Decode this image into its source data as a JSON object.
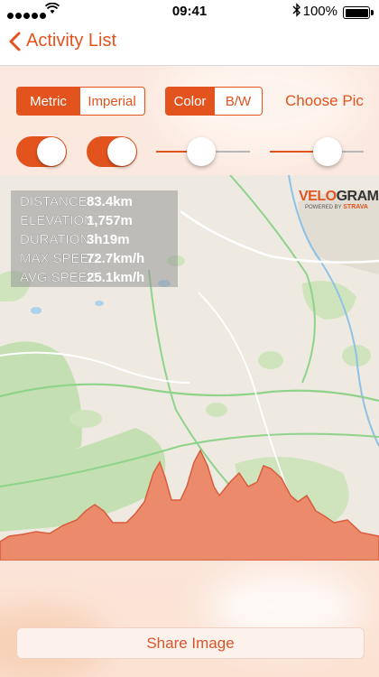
{
  "status_bar": {
    "time": "09:41",
    "battery": "100%",
    "battery_level": 1.0
  },
  "nav": {
    "back_label": "Activity List"
  },
  "controls": {
    "units": {
      "options": [
        "Metric",
        "Imperial"
      ],
      "selected": "Metric"
    },
    "color_mode": {
      "options": [
        "Color",
        "B/W"
      ],
      "selected": "Color"
    },
    "choose_pic_label": "Choose Pic",
    "toggles": [
      {
        "name": "toggle-1",
        "on": true
      },
      {
        "name": "toggle-2",
        "on": true
      }
    ],
    "sliders": [
      {
        "name": "slider-1",
        "value": 0.48
      },
      {
        "name": "slider-2",
        "value": 0.62
      }
    ]
  },
  "stats": [
    {
      "label": "DISTANCE",
      "value": "83.4km"
    },
    {
      "label": "ELEVATION",
      "value": "1,757m"
    },
    {
      "label": "DURATION",
      "value": "3h19m"
    },
    {
      "label": "MAX SPEED",
      "value": "72.7km/h"
    },
    {
      "label": "AVG SPEED",
      "value": "25.1km/h"
    }
  ],
  "logo": {
    "part1": "VELO",
    "part2": "GRAM",
    "powered": "POWERED BY",
    "strava": "STRAVA"
  },
  "share_label": "Share Image",
  "colors": {
    "accent": "#e2531e",
    "elevation_fill": "#ec8a6c"
  }
}
